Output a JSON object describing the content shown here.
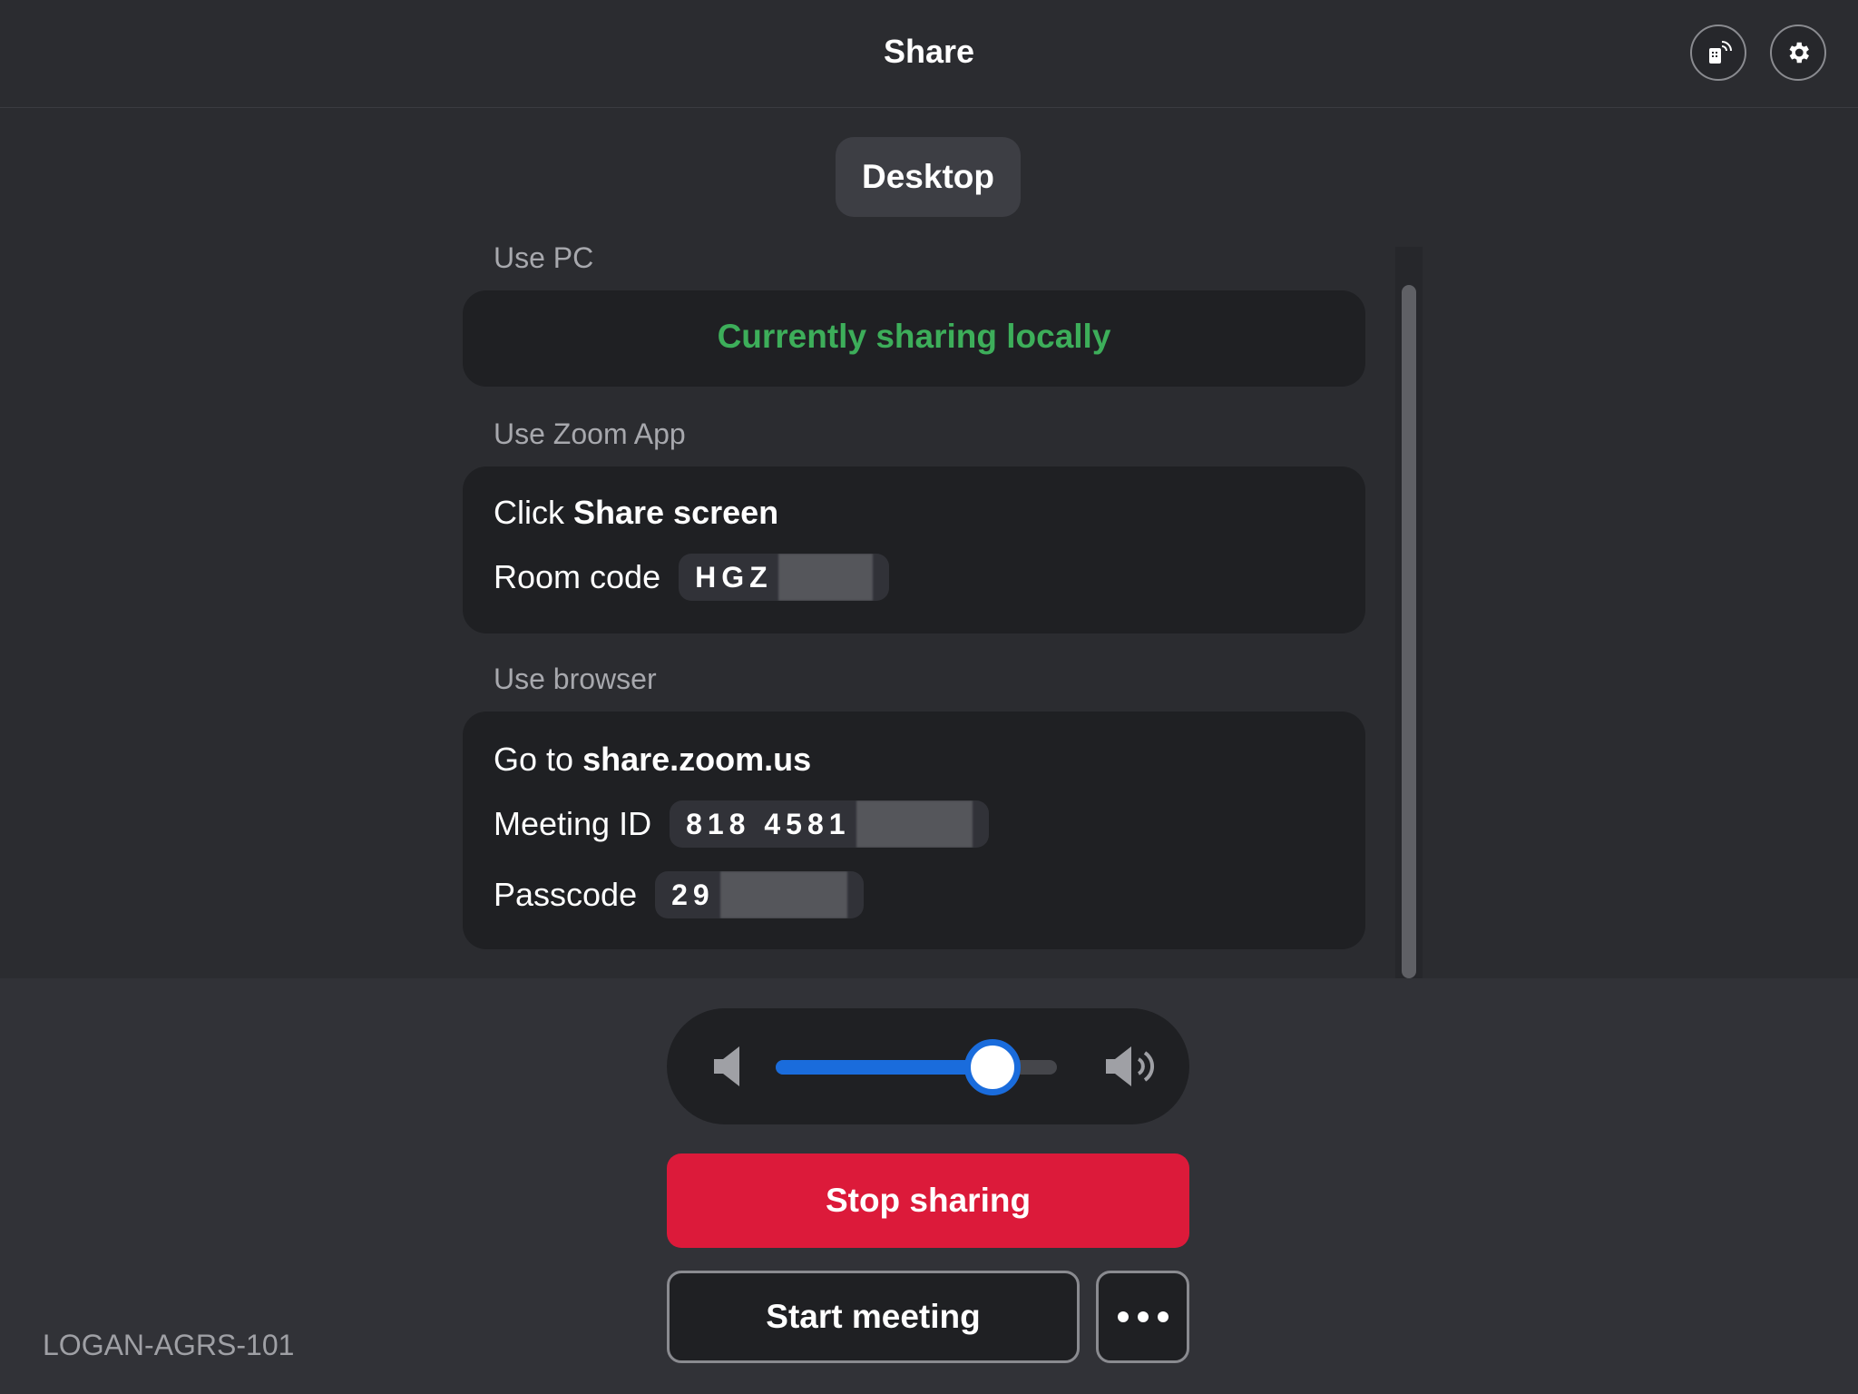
{
  "header": {
    "title": "Share",
    "icons": [
      "cast-device-icon",
      "settings-gear-icon"
    ]
  },
  "mode": {
    "label": "Desktop"
  },
  "sections": {
    "pc": {
      "label": "Use PC",
      "status": "Currently sharing locally",
      "status_color": "#3dae5a"
    },
    "zoom_app": {
      "label": "Use Zoom App",
      "instruction_prefix": "Click ",
      "instruction_bold": "Share screen",
      "room_code_label": "Room code",
      "room_code_visible": "HGZ"
    },
    "browser": {
      "label": "Use browser",
      "instruction_prefix": "Go to ",
      "instruction_bold": "share.zoom.us",
      "meeting_id_label": "Meeting ID",
      "meeting_id_visible": "818 4581",
      "passcode_label": "Passcode",
      "passcode_visible": "29"
    }
  },
  "volume": {
    "level_percent": 77,
    "icons": [
      "volume-mute-icon",
      "volume-up-icon"
    ]
  },
  "buttons": {
    "stop_sharing": "Stop sharing",
    "start_meeting": "Start meeting",
    "more_icon": "more-horizontal-icon"
  },
  "device": {
    "name": "LOGAN-AGRS-101"
  },
  "colors": {
    "accent_blue": "#1a6cdc",
    "stop_red": "#dc1a3a",
    "background": "#2b2c30"
  }
}
